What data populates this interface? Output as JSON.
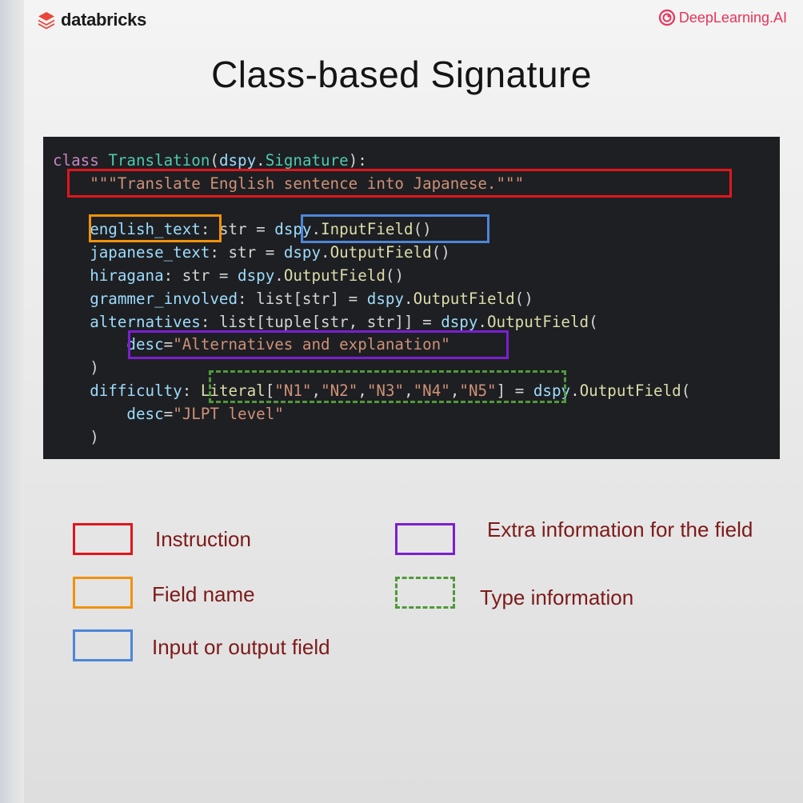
{
  "header": {
    "left_brand": "databricks",
    "right_brand": "DeepLearning.AI"
  },
  "slide": {
    "title": "Class-based Signature"
  },
  "code": {
    "lines": [
      [
        {
          "t": "class ",
          "c": "kw"
        },
        {
          "t": "Translation",
          "c": "cls"
        },
        {
          "t": "(",
          "c": "op"
        },
        {
          "t": "dspy",
          "c": "id"
        },
        {
          "t": ".",
          "c": "op"
        },
        {
          "t": "Signature",
          "c": "cls"
        },
        {
          "t": "):",
          "c": "op"
        }
      ],
      [
        {
          "t": "    \"\"\"Translate English sentence into Japanese.\"\"\"",
          "c": "str"
        }
      ],
      [],
      [
        {
          "t": "    english_text",
          "c": "id"
        },
        {
          "t": ": str = ",
          "c": "op"
        },
        {
          "t": "dspy",
          "c": "id"
        },
        {
          "t": ".",
          "c": "op"
        },
        {
          "t": "InputField",
          "c": "fn"
        },
        {
          "t": "()",
          "c": "op"
        }
      ],
      [
        {
          "t": "    japanese_text",
          "c": "id"
        },
        {
          "t": ": str = ",
          "c": "op"
        },
        {
          "t": "dspy",
          "c": "id"
        },
        {
          "t": ".",
          "c": "op"
        },
        {
          "t": "OutputField",
          "c": "fn"
        },
        {
          "t": "()",
          "c": "op"
        }
      ],
      [
        {
          "t": "    hiragana",
          "c": "id"
        },
        {
          "t": ": str = ",
          "c": "op"
        },
        {
          "t": "dspy",
          "c": "id"
        },
        {
          "t": ".",
          "c": "op"
        },
        {
          "t": "OutputField",
          "c": "fn"
        },
        {
          "t": "()",
          "c": "op"
        }
      ],
      [
        {
          "t": "    grammer_involved",
          "c": "id"
        },
        {
          "t": ": list[str] = ",
          "c": "op"
        },
        {
          "t": "dspy",
          "c": "id"
        },
        {
          "t": ".",
          "c": "op"
        },
        {
          "t": "OutputField",
          "c": "fn"
        },
        {
          "t": "()",
          "c": "op"
        }
      ],
      [
        {
          "t": "    alternatives",
          "c": "id"
        },
        {
          "t": ": list[tuple[str, str]] = ",
          "c": "op"
        },
        {
          "t": "dspy",
          "c": "id"
        },
        {
          "t": ".",
          "c": "op"
        },
        {
          "t": "OutputField",
          "c": "fn"
        },
        {
          "t": "(",
          "c": "op"
        }
      ],
      [
        {
          "t": "        desc",
          "c": "id"
        },
        {
          "t": "=",
          "c": "op"
        },
        {
          "t": "\"Alternatives and explanation\"",
          "c": "str"
        }
      ],
      [
        {
          "t": "    )",
          "c": "op"
        }
      ],
      [
        {
          "t": "    difficulty",
          "c": "id"
        },
        {
          "t": ": ",
          "c": "op"
        },
        {
          "t": "Literal",
          "c": "fn"
        },
        {
          "t": "[",
          "c": "op"
        },
        {
          "t": "\"N1\"",
          "c": "str"
        },
        {
          "t": ",",
          "c": "op"
        },
        {
          "t": "\"N2\"",
          "c": "str"
        },
        {
          "t": ",",
          "c": "op"
        },
        {
          "t": "\"N3\"",
          "c": "str"
        },
        {
          "t": ",",
          "c": "op"
        },
        {
          "t": "\"N4\"",
          "c": "str"
        },
        {
          "t": ",",
          "c": "op"
        },
        {
          "t": "\"N5\"",
          "c": "str"
        },
        {
          "t": "]",
          "c": "op"
        },
        {
          "t": " = ",
          "c": "op"
        },
        {
          "t": "dspy",
          "c": "id"
        },
        {
          "t": ".",
          "c": "op"
        },
        {
          "t": "OutputField",
          "c": "fn"
        },
        {
          "t": "(",
          "c": "op"
        }
      ],
      [
        {
          "t": "        desc",
          "c": "id"
        },
        {
          "t": "=",
          "c": "op"
        },
        {
          "t": "\"JLPT level\"",
          "c": "str"
        }
      ],
      [
        {
          "t": "    )",
          "c": "op"
        }
      ]
    ]
  },
  "legend": {
    "instruction": "Instruction",
    "field_name": "Field name",
    "input_output": "Input or output field",
    "extra_info": "Extra information for the field",
    "type_info": "Type information"
  },
  "colors": {
    "instruction": "#e0161c",
    "field_name": "#f0920a",
    "input_output": "#4d86d9",
    "extra_info": "#7b1fd1",
    "type_info": "#4e9a3a"
  }
}
